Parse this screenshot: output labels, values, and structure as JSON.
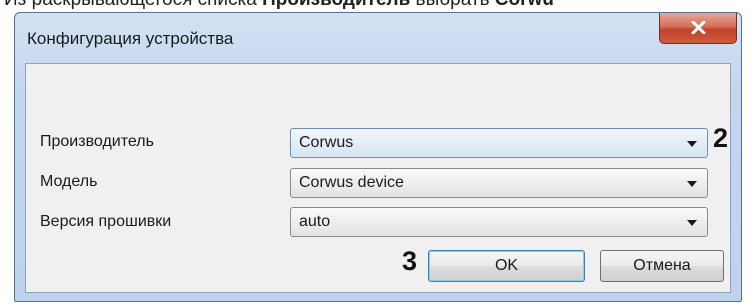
{
  "doc": {
    "prefix": "Из раскрывающегося списка ",
    "bold1": "Производитель",
    "middle": " выбрать ",
    "bold2": "Corwu"
  },
  "window": {
    "title": "Конфигурация устройства"
  },
  "form": {
    "fields": [
      {
        "label": "Производитель",
        "value": "Corwus",
        "callout": "2"
      },
      {
        "label": "Модель",
        "value": "Corwus device"
      },
      {
        "label": "Версия прошивки",
        "value": "auto"
      }
    ]
  },
  "buttons": {
    "ok_label": "OK",
    "ok_callout": "3",
    "cancel_label": "Отмена"
  },
  "icons": {
    "close": "close-icon",
    "dropdown": "chevron-down-icon"
  },
  "colors": {
    "title_bar": "#c2d6ee",
    "close_button": "#c2432b",
    "client_bg": "#f0f0f0",
    "default_button_border": "#3c7fb1"
  }
}
